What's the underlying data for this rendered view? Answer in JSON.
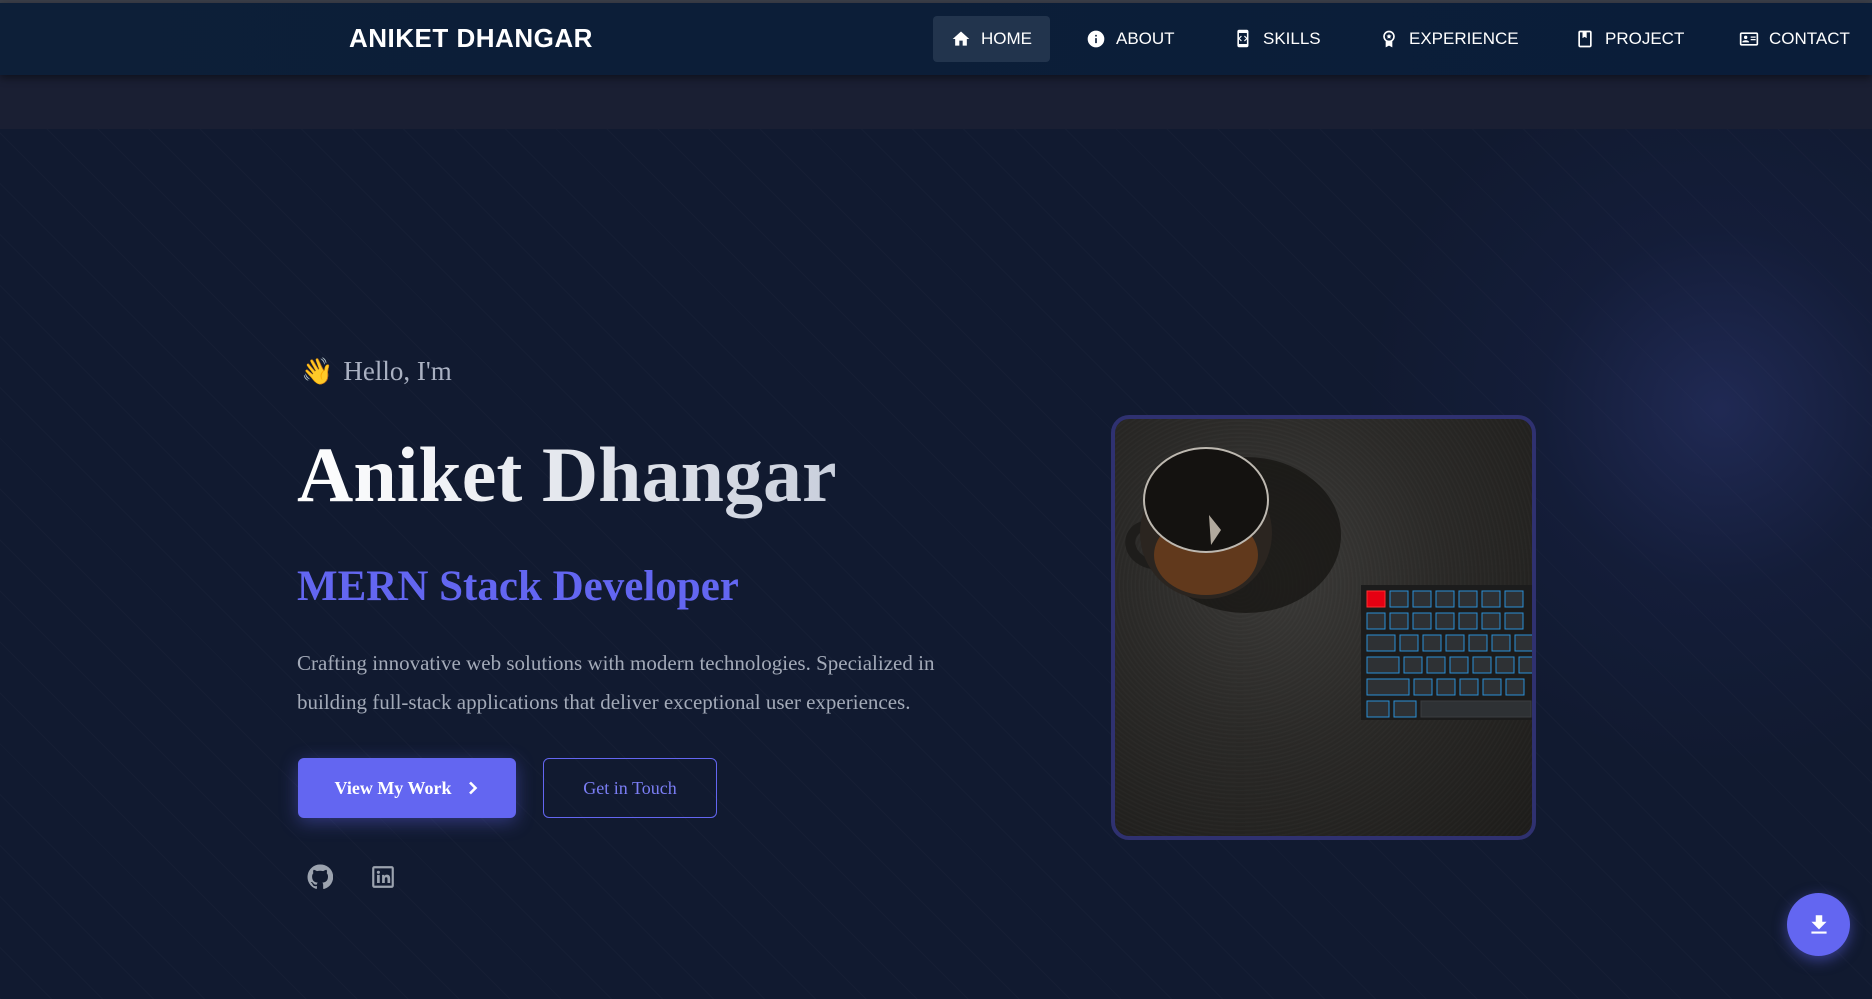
{
  "nav": {
    "brand": "ANIKET DHANGAR",
    "items": [
      {
        "label": "HOME",
        "icon": "home-icon",
        "active": true
      },
      {
        "label": "ABOUT",
        "icon": "info-icon",
        "active": false
      },
      {
        "label": "SKILLS",
        "icon": "code-device-icon",
        "active": false
      },
      {
        "label": "EXPERIENCE",
        "icon": "award-icon",
        "active": false
      },
      {
        "label": "PROJECT",
        "icon": "book-icon",
        "active": false
      },
      {
        "label": "CONTACT",
        "icon": "contact-card-icon",
        "active": false
      }
    ]
  },
  "hero": {
    "greeting_emoji": "👋",
    "greeting": "Hello, I'm",
    "name": "Aniket Dhangar",
    "role": "MERN Stack Developer",
    "description": "Crafting innovative web solutions with modern technologies. Specialized in building full-stack applications that deliver exceptional user experiences.",
    "primary_button": "View My Work",
    "secondary_button": "Get in Touch",
    "social": [
      {
        "icon": "github-icon"
      },
      {
        "icon": "linkedin-icon"
      }
    ]
  },
  "colors": {
    "accent": "#6366f1",
    "navbar": "#0d1f38",
    "background": "#111a30"
  },
  "fab": {
    "icon": "download-icon"
  }
}
